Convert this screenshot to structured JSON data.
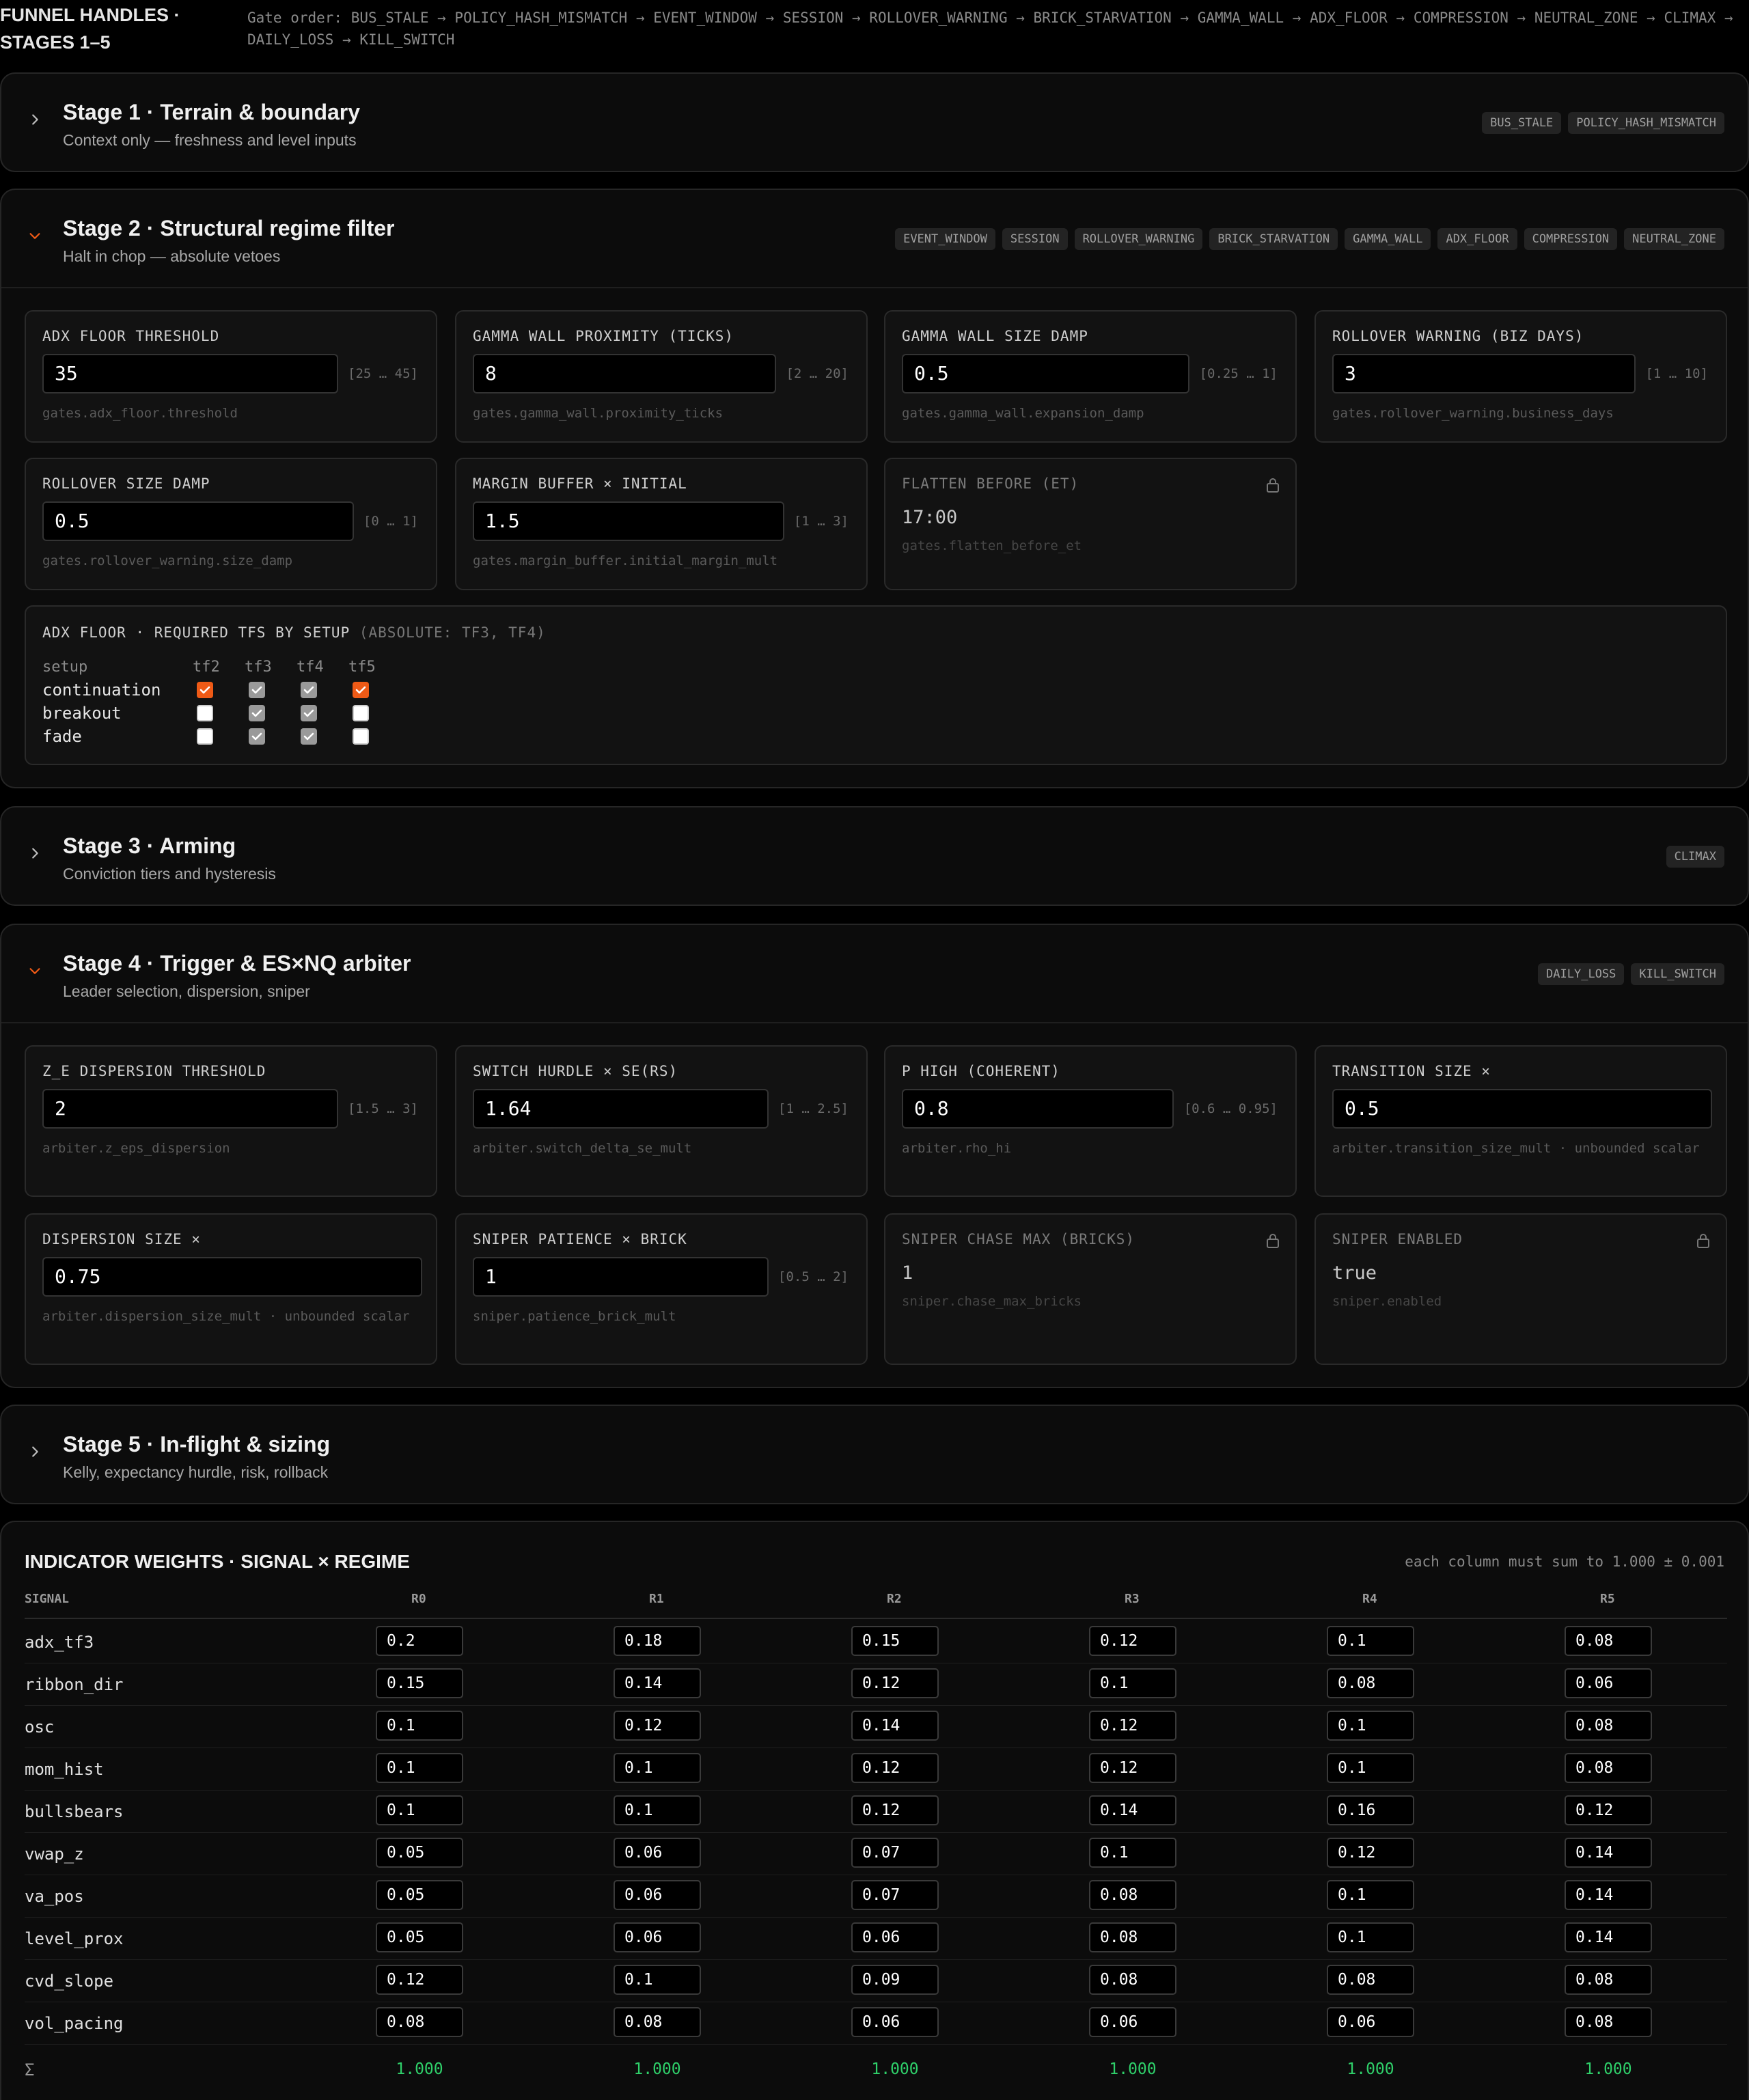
{
  "header": {
    "title": "FUNNEL HANDLES · STAGES 1–5",
    "gate_order": "Gate order: BUS_STALE → POLICY_HASH_MISMATCH → EVENT_WINDOW → SESSION → ROLLOVER_WARNING → BRICK_STARVATION → GAMMA_WALL → ADX_FLOOR → COMPRESSION → NEUTRAL_ZONE → CLIMAX → DAILY_LOSS → KILL_SWITCH"
  },
  "stage1": {
    "title": "Stage 1 · Terrain & boundary",
    "subtitle": "Context only — freshness and level inputs",
    "badges": [
      "BUS_STALE",
      "POLICY_HASH_MISMATCH"
    ],
    "expanded": false
  },
  "stage2": {
    "title": "Stage 2 · Structural regime filter",
    "subtitle": "Halt in chop — absolute vetoes",
    "badges": [
      "EVENT_WINDOW",
      "SESSION",
      "ROLLOVER_WARNING",
      "BRICK_STARVATION",
      "GAMMA_WALL",
      "ADX_FLOOR",
      "COMPRESSION",
      "NEUTRAL_ZONE"
    ],
    "expanded": true,
    "fields": [
      {
        "label": "ADX FLOOR THRESHOLD",
        "value": "35",
        "range": "[25 … 45]",
        "path": "gates.adx_floor.threshold"
      },
      {
        "label": "GAMMA WALL PROXIMITY (TICKS)",
        "value": "8",
        "range": "[2 … 20]",
        "path": "gates.gamma_wall.proximity_ticks"
      },
      {
        "label": "GAMMA WALL SIZE DAMP",
        "value": "0.5",
        "range": "[0.25 … 1]",
        "path": "gates.gamma_wall.expansion_damp"
      },
      {
        "label": "ROLLOVER WARNING (BIZ DAYS)",
        "value": "3",
        "range": "[1 … 10]",
        "path": "gates.rollover_warning.business_days"
      },
      {
        "label": "ROLLOVER SIZE DAMP",
        "value": "0.5",
        "range": "[0 … 1]",
        "path": "gates.rollover_warning.size_damp"
      },
      {
        "label": "MARGIN BUFFER × INITIAL",
        "value": "1.5",
        "range": "[1 … 3]",
        "path": "gates.margin_buffer.initial_margin_mult"
      },
      {
        "label": "FLATTEN BEFORE (ET)",
        "value": "17:00",
        "range": "",
        "path": "gates.flatten_before_et",
        "locked": true
      }
    ],
    "adx_matrix": {
      "title": "ADX FLOOR · REQUIRED TFS BY SETUP",
      "note": "(ABSOLUTE: TF3, TF4)",
      "setup_header": "setup",
      "columns": [
        "tf2",
        "tf3",
        "tf4",
        "tf5"
      ],
      "rows": [
        {
          "name": "continuation",
          "states": [
            "on",
            "abs",
            "abs",
            "on"
          ]
        },
        {
          "name": "breakout",
          "states": [
            "off",
            "abs",
            "abs",
            "off"
          ]
        },
        {
          "name": "fade",
          "states": [
            "off",
            "abs",
            "abs",
            "off"
          ]
        }
      ]
    }
  },
  "stage3": {
    "title": "Stage 3 · Arming",
    "subtitle": "Conviction tiers and hysteresis",
    "badges": [
      "CLIMAX"
    ],
    "expanded": false
  },
  "stage4": {
    "title": "Stage 4 · Trigger & ES×NQ arbiter",
    "subtitle": "Leader selection, dispersion, sniper",
    "badges": [
      "DAILY_LOSS",
      "KILL_SWITCH"
    ],
    "expanded": true,
    "fields": [
      {
        "label": "Z_E DISPERSION THRESHOLD",
        "value": "2",
        "range": "[1.5 … 3]",
        "path": "arbiter.z_eps_dispersion"
      },
      {
        "label": "SWITCH HURDLE × SE(RS)",
        "value": "1.64",
        "range": "[1 … 2.5]",
        "path": "arbiter.switch_delta_se_mult"
      },
      {
        "label": "P HIGH (COHERENT)",
        "value": "0.8",
        "range": "[0.6 … 0.95]",
        "path": "arbiter.rho_hi"
      },
      {
        "label": "TRANSITION SIZE ×",
        "value": "0.5",
        "range": "",
        "path": "arbiter.transition_size_mult · unbounded scalar"
      },
      {
        "label": "DISPERSION SIZE ×",
        "value": "0.75",
        "range": "",
        "path": "arbiter.dispersion_size_mult · unbounded scalar"
      },
      {
        "label": "SNIPER PATIENCE × BRICK",
        "value": "1",
        "range": "[0.5 … 2]",
        "path": "sniper.patience_brick_mult"
      },
      {
        "label": "SNIPER CHASE MAX (BRICKS)",
        "value": "1",
        "range": "",
        "path": "sniper.chase_max_bricks",
        "locked": true
      },
      {
        "label": "SNIPER ENABLED",
        "value": "true",
        "range": "",
        "path": "sniper.enabled",
        "locked": true
      }
    ]
  },
  "stage5": {
    "title": "Stage 5 · In-flight & sizing",
    "subtitle": "Kelly, expectancy hurdle, risk, rollback",
    "badges": [],
    "expanded": false
  },
  "weights": {
    "title": "INDICATOR WEIGHTS · SIGNAL × REGIME",
    "note": "each column must sum to 1.000 ± 0.001",
    "signal_header": "SIGNAL",
    "regimes": [
      "R0",
      "R1",
      "R2",
      "R3",
      "R4",
      "R5"
    ],
    "rows": [
      {
        "signal": "adx_tf3",
        "values": [
          "0.2",
          "0.18",
          "0.15",
          "0.12",
          "0.1",
          "0.08"
        ]
      },
      {
        "signal": "ribbon_dir",
        "values": [
          "0.15",
          "0.14",
          "0.12",
          "0.1",
          "0.08",
          "0.06"
        ]
      },
      {
        "signal": "osc",
        "values": [
          "0.1",
          "0.12",
          "0.14",
          "0.12",
          "0.1",
          "0.08"
        ]
      },
      {
        "signal": "mom_hist",
        "values": [
          "0.1",
          "0.1",
          "0.12",
          "0.12",
          "0.1",
          "0.08"
        ]
      },
      {
        "signal": "bullsbears",
        "values": [
          "0.1",
          "0.1",
          "0.12",
          "0.14",
          "0.16",
          "0.12"
        ]
      },
      {
        "signal": "vwap_z",
        "values": [
          "0.05",
          "0.06",
          "0.07",
          "0.1",
          "0.12",
          "0.14"
        ]
      },
      {
        "signal": "va_pos",
        "values": [
          "0.05",
          "0.06",
          "0.07",
          "0.08",
          "0.1",
          "0.14"
        ]
      },
      {
        "signal": "level_prox",
        "values": [
          "0.05",
          "0.06",
          "0.06",
          "0.08",
          "0.1",
          "0.14"
        ]
      },
      {
        "signal": "cvd_slope",
        "values": [
          "0.12",
          "0.1",
          "0.09",
          "0.08",
          "0.08",
          "0.08"
        ]
      },
      {
        "signal": "vol_pacing",
        "values": [
          "0.08",
          "0.08",
          "0.06",
          "0.06",
          "0.06",
          "0.08"
        ]
      }
    ],
    "sum_symbol": "Σ",
    "sums": [
      "1.000",
      "1.000",
      "1.000",
      "1.000",
      "1.000",
      "1.000"
    ],
    "colors": {
      "sum_ok": "#2fd06a",
      "accent": "#ef5a16"
    }
  }
}
